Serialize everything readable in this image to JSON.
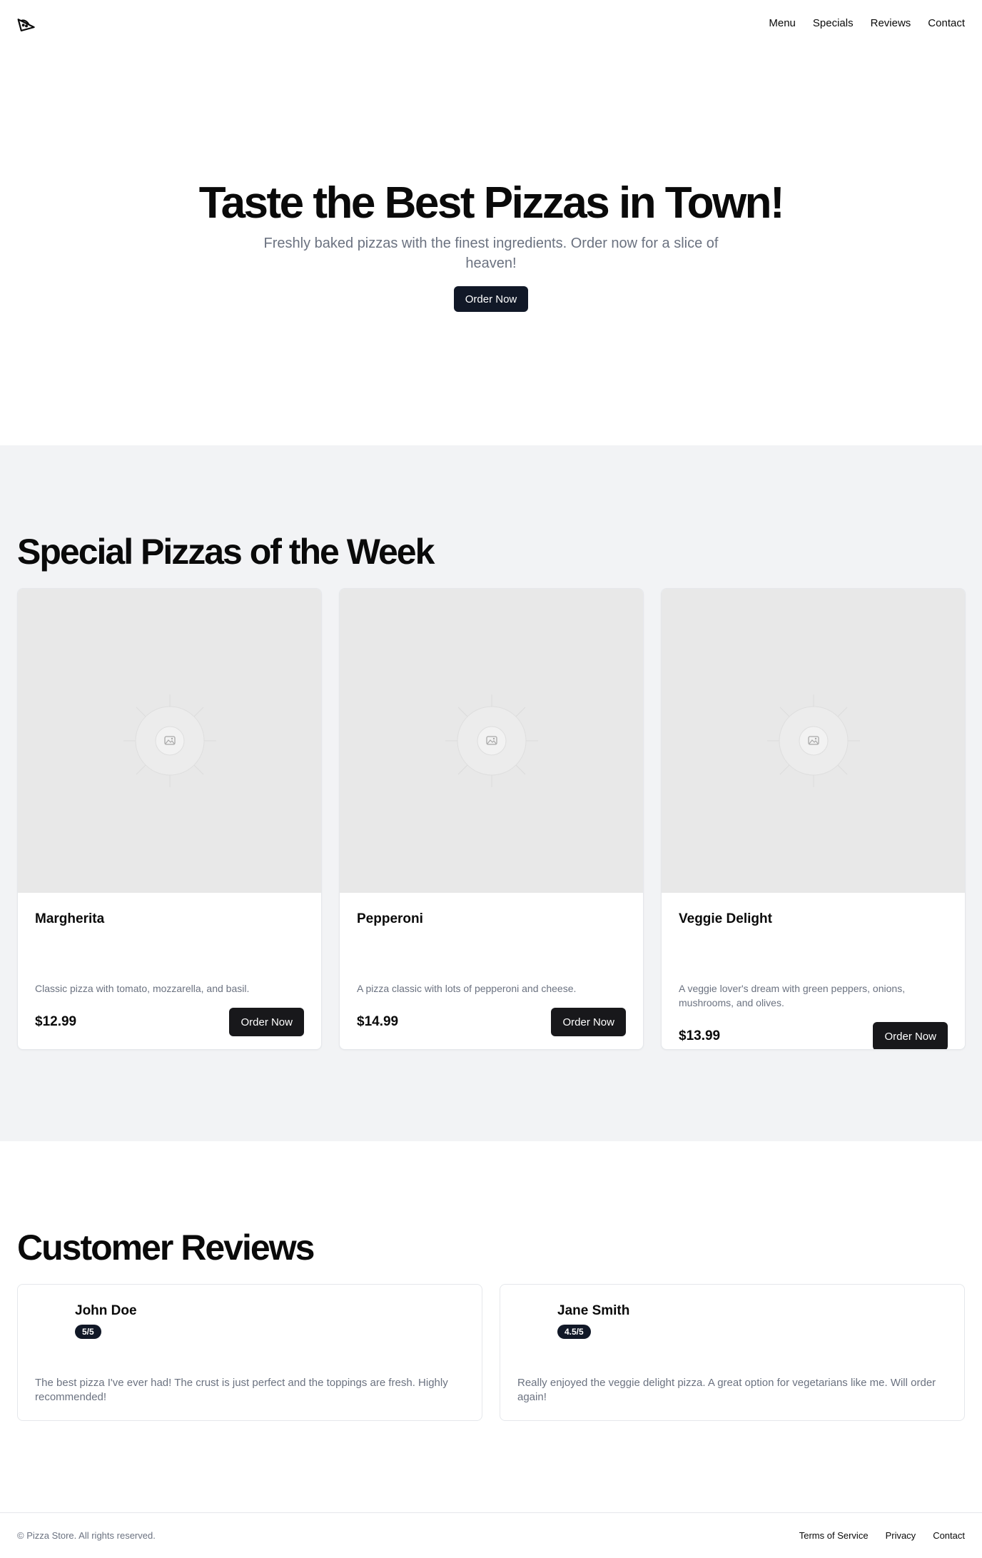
{
  "nav": {
    "logo_icon": "pizza-slice-icon",
    "links": [
      "Menu",
      "Specials",
      "Reviews",
      "Contact"
    ]
  },
  "hero": {
    "title": "Taste the Best Pizzas in Town!",
    "subtitle": "Freshly baked pizzas with the finest ingredients. Order now for a slice of heaven!",
    "cta": "Order Now"
  },
  "specials": {
    "title": "Special Pizzas of the Week",
    "items": [
      {
        "name": "Margherita",
        "description": "Classic pizza with tomato, mozzarella, and basil.",
        "price": "$12.99",
        "button": "Order Now",
        "image_icon": "image-placeholder-icon"
      },
      {
        "name": "Pepperoni",
        "description": "A pizza classic with lots of pepperoni and cheese.",
        "price": "$14.99",
        "button": "Order Now",
        "image_icon": "image-placeholder-icon"
      },
      {
        "name": "Veggie Delight",
        "description": "A veggie lover's dream with green peppers, onions, mushrooms, and olives.",
        "price": "$13.99",
        "button": "Order Now",
        "image_icon": "image-placeholder-icon"
      }
    ]
  },
  "reviews": {
    "title": "Customer Reviews",
    "items": [
      {
        "name": "John Doe",
        "rating": "5/5",
        "text": "The best pizza I've ever had! The crust is just perfect and the toppings are fresh. Highly recommended!"
      },
      {
        "name": "Jane Smith",
        "rating": "4.5/5",
        "text": "Really enjoyed the veggie delight pizza. A great option for vegetarians like me. Will order again!"
      }
    ]
  },
  "footer": {
    "copyright": "© Pizza Store. All rights reserved.",
    "links": [
      "Terms of Service",
      "Privacy",
      "Contact"
    ]
  },
  "colors": {
    "primary_button": "#111827",
    "section_bg": "#f2f3f5",
    "muted_text": "#6b7280"
  }
}
